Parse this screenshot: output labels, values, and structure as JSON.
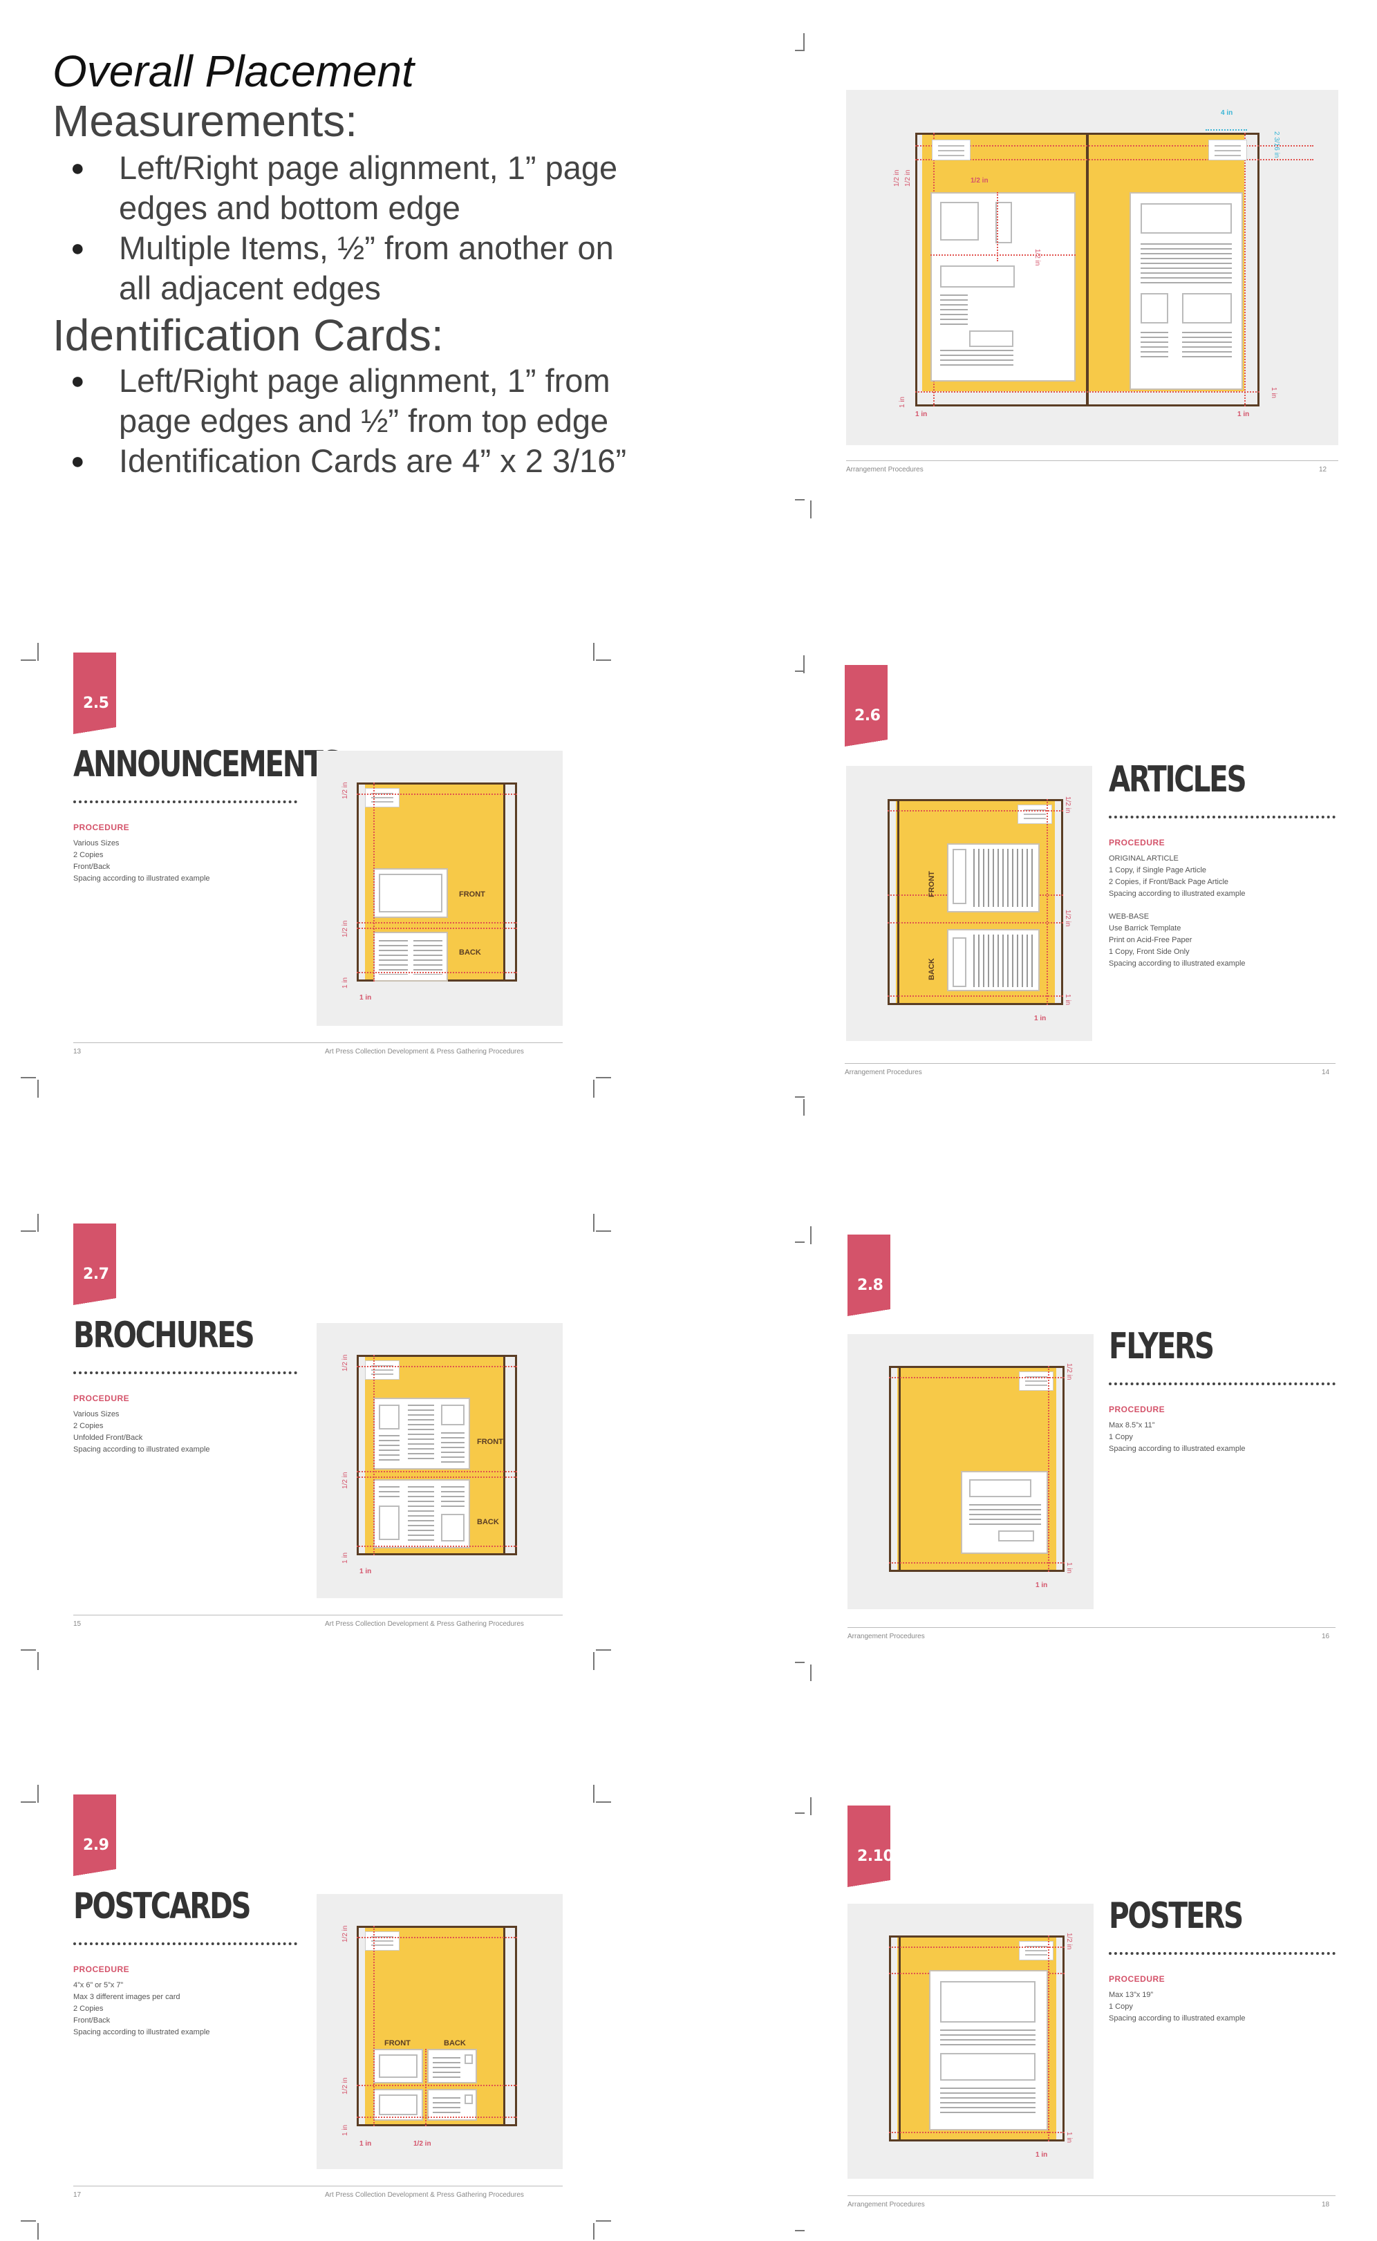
{
  "intro": {
    "title": "Overall Placement",
    "measurements_heading": "Measurements:",
    "measurements": [
      "Left/Right page alignment, 1” page edges and bottom edge",
      "Multiple Items, ½” from another on all adjacent edges"
    ],
    "id_heading": "Identification Cards:",
    "id_items": [
      "Left/Right page alignment, 1” from page edges and ½” from top edge",
      "Identification Cards are 4” x 2 3/16”"
    ]
  },
  "overview": {
    "labels": {
      "w4": "4 in",
      "h2": "2 3/16 in",
      "half": "1/2 in",
      "one": "1 in"
    },
    "footer_left": "Arrangement Procedures",
    "footer_page": "12"
  },
  "sections": {
    "announcements": {
      "tab": "2.5",
      "title": "ANNOUNCEMENTS",
      "procedure": "PROCEDURE",
      "lines": [
        "Various Sizes",
        "2 Copies",
        "Front/Back",
        "Spacing according to illustrated example"
      ],
      "front": "FRONT",
      "back": "BACK",
      "half": "1/2 in",
      "one": "1 in",
      "footer_page": "13",
      "footer_right": "Art Press Collection Development & Press Gathering Procedures"
    },
    "articles": {
      "tab": "2.6",
      "title": "ARTICLES",
      "procedure": "PROCEDURE",
      "lines1": [
        "ORIGINAL ARTICLE",
        "1 Copy, if Single Page Article",
        "2 Copies, if Front/Back Page Article",
        "Spacing according to illustrated example"
      ],
      "lines2": [
        "WEB-BASE",
        "Use Barrick Template",
        "Print on Acid-Free Paper",
        "1 Copy, Front Side Only",
        "Spacing according to illustrated example"
      ],
      "front": "FRONT",
      "back": "BACK",
      "half": "1/2 in",
      "one": "1 in",
      "footer_left": "Arrangement Procedures",
      "footer_page": "14"
    },
    "brochures": {
      "tab": "2.7",
      "title": "BROCHURES",
      "procedure": "PROCEDURE",
      "lines": [
        "Various Sizes",
        "2 Copies",
        "Unfolded Front/Back",
        "Spacing according to illustrated example"
      ],
      "front": "FRONT",
      "back": "BACK",
      "half": "1/2 in",
      "one": "1 in",
      "footer_page": "15",
      "footer_right": "Art Press Collection Development & Press Gathering Procedures"
    },
    "flyers": {
      "tab": "2.8",
      "title": "FLYERS",
      "procedure": "PROCEDURE",
      "lines": [
        "Max 8.5”x 11”",
        "1 Copy",
        "Spacing according to illustrated example"
      ],
      "half": "1/2 in",
      "one": "1 in",
      "footer_left": "Arrangement Procedures",
      "footer_page": "16"
    },
    "postcards": {
      "tab": "2.9",
      "title": "POSTCARDS",
      "procedure": "PROCEDURE",
      "lines": [
        "4”x 6” or 5”x 7”",
        "Max 3 different images per card",
        "2 Copies",
        "Front/Back",
        "Spacing according to illustrated example"
      ],
      "front": "FRONT",
      "back": "BACK",
      "half": "1/2 in",
      "one": "1 in",
      "footer_page": "17",
      "footer_right": "Art Press Collection Development & Press Gathering Procedures"
    },
    "posters": {
      "tab": "2.10",
      "title": "POSTERS",
      "procedure": "PROCEDURE",
      "lines": [
        "Max 13”x 19”",
        "1 Copy",
        "Spacing according to illustrated example"
      ],
      "half": "1/2 in",
      "one": "1 in",
      "footer_left": "Arrangement Procedures",
      "footer_page": "18"
    }
  }
}
